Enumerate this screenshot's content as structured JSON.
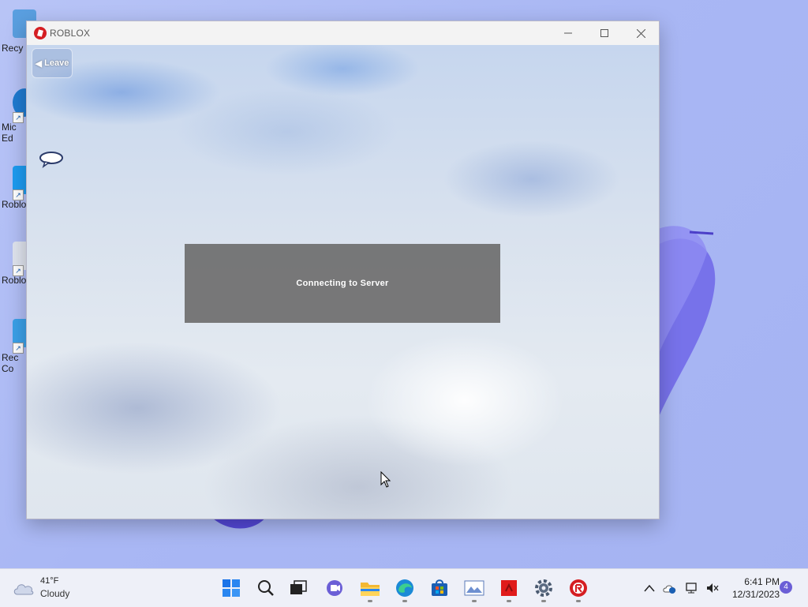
{
  "desktop": {
    "icons": [
      {
        "label": "Recy",
        "color": "#3a86d8"
      },
      {
        "label": "Mic\nEd",
        "color": "#1f7ad0"
      },
      {
        "label": "Roblo",
        "color": "#1d9bf0"
      },
      {
        "label": "Roblo",
        "color": "#dfe4ee"
      },
      {
        "label": "Rec\nCo",
        "color": "#3aa0e8"
      }
    ]
  },
  "window": {
    "title": "ROBLOX",
    "leave_label": "Leave",
    "status_message": "Connecting to Server"
  },
  "taskbar": {
    "weather": {
      "temp": "41°F",
      "condition": "Cloudy"
    },
    "apps": [
      "start-icon",
      "search-icon",
      "task-view-icon",
      "chat-icon",
      "file-explorer-icon",
      "edge-icon",
      "store-icon",
      "photos-icon",
      "red-app-icon",
      "settings-icon",
      "roblox-icon"
    ],
    "clock": {
      "time": "6:41 PM",
      "date": "12/31/2023"
    },
    "notification_count": "4"
  },
  "colors": {
    "roblox_red": "#d51e22",
    "panel_gray": "#6e6e6e",
    "accent": "#6b5fd6"
  }
}
